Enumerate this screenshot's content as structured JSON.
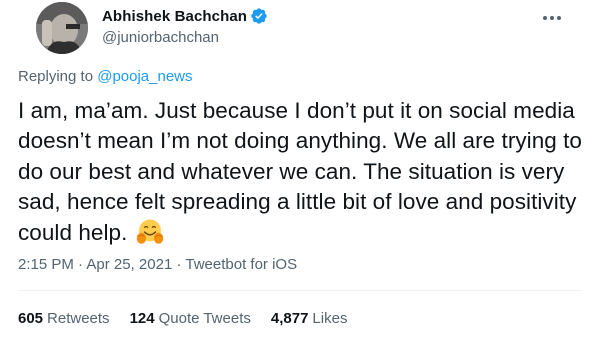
{
  "user": {
    "display_name": "Abhishek Bachchan",
    "handle": "@juniorbachchan",
    "verified": true,
    "verified_color": "#1d9bf0"
  },
  "reply": {
    "prefix": "Replying to",
    "mention": "@pooja_news"
  },
  "tweet": {
    "text": "I am, ma’am. Just because I don’t put it on social media doesn’t mean I’m not doing anything. We all are trying to do our best and whatever we can. The situation is very sad, hence felt spreading a little bit of love and positivity could help.",
    "emoji": "hugging-face-emoji"
  },
  "meta": {
    "time": "2:15 PM",
    "separator1": " · ",
    "date": "Apr 25, 2021",
    "separator2": " · ",
    "source": "Tweetbot for iOS"
  },
  "stats": {
    "retweets_count": "605",
    "retweets_label": "Retweets",
    "quotes_count": "124",
    "quotes_label": "Quote Tweets",
    "likes_count": "4,877",
    "likes_label": "Likes"
  },
  "colors": {
    "link": "#1d9bf0",
    "secondary_text": "#536471",
    "primary_text": "#0f1419"
  }
}
